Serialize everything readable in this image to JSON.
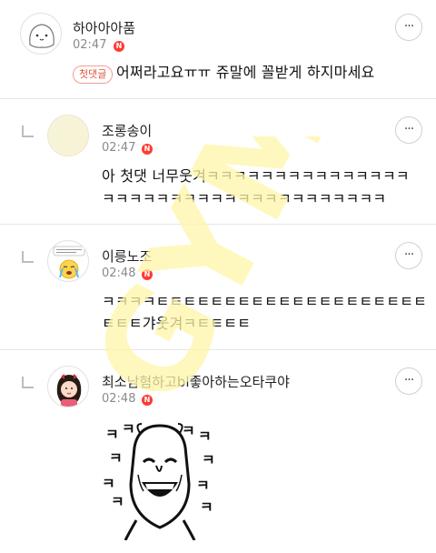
{
  "comments": [
    {
      "name": "하아아아품",
      "time": "02:47",
      "badge": "N",
      "tag": "첫댓글",
      "text": "어쩌라고요ㅠㅠ 쥬말에 꼴받게 하지마세요",
      "avatar_icon": "blob-face-icon"
    },
    {
      "name": "조롱송이",
      "time": "02:47",
      "badge": "N",
      "lines": [
        "아 첫댓 너무웃겨ㅋㅋㅋㅋㅋㅋㅋㅋㅋㅋㅋㅋㅋㅋㅋ",
        "ㅋㅋㅋㅋㅋㅋㅋㅋㅋㅋㅋㅋㅋㅋㅋㅋㅋㅋㅋㅋㅋ"
      ],
      "avatar_icon": "cream-circle-icon"
    },
    {
      "name": "이릉노조",
      "time": "02:48",
      "badge": "N",
      "lines": [
        "ㅋㅋㅋㅋㅌㅌㅌㅌㅌㅌㅌㅌㅌㅌㅌㅌㅌㅌㅌㅌㅌㅌㅌㅌ",
        "ㅌㅌㅌ갸웃겨ㅋㅌㅌㅌㅌ"
      ],
      "avatar_icon": "crying-face-icon"
    },
    {
      "name": "최소남혐하고bl좋아하는오타쿠야",
      "time": "02:48",
      "badge": "N",
      "sticker_label": "ㅋ",
      "avatar_icon": "girl-avatar-icon"
    }
  ],
  "more_label": "···",
  "watermark_text": "GYM",
  "colors": {
    "badge": "#ff3b30",
    "tag": "#e0533a",
    "watermark": "#fff3a0"
  }
}
